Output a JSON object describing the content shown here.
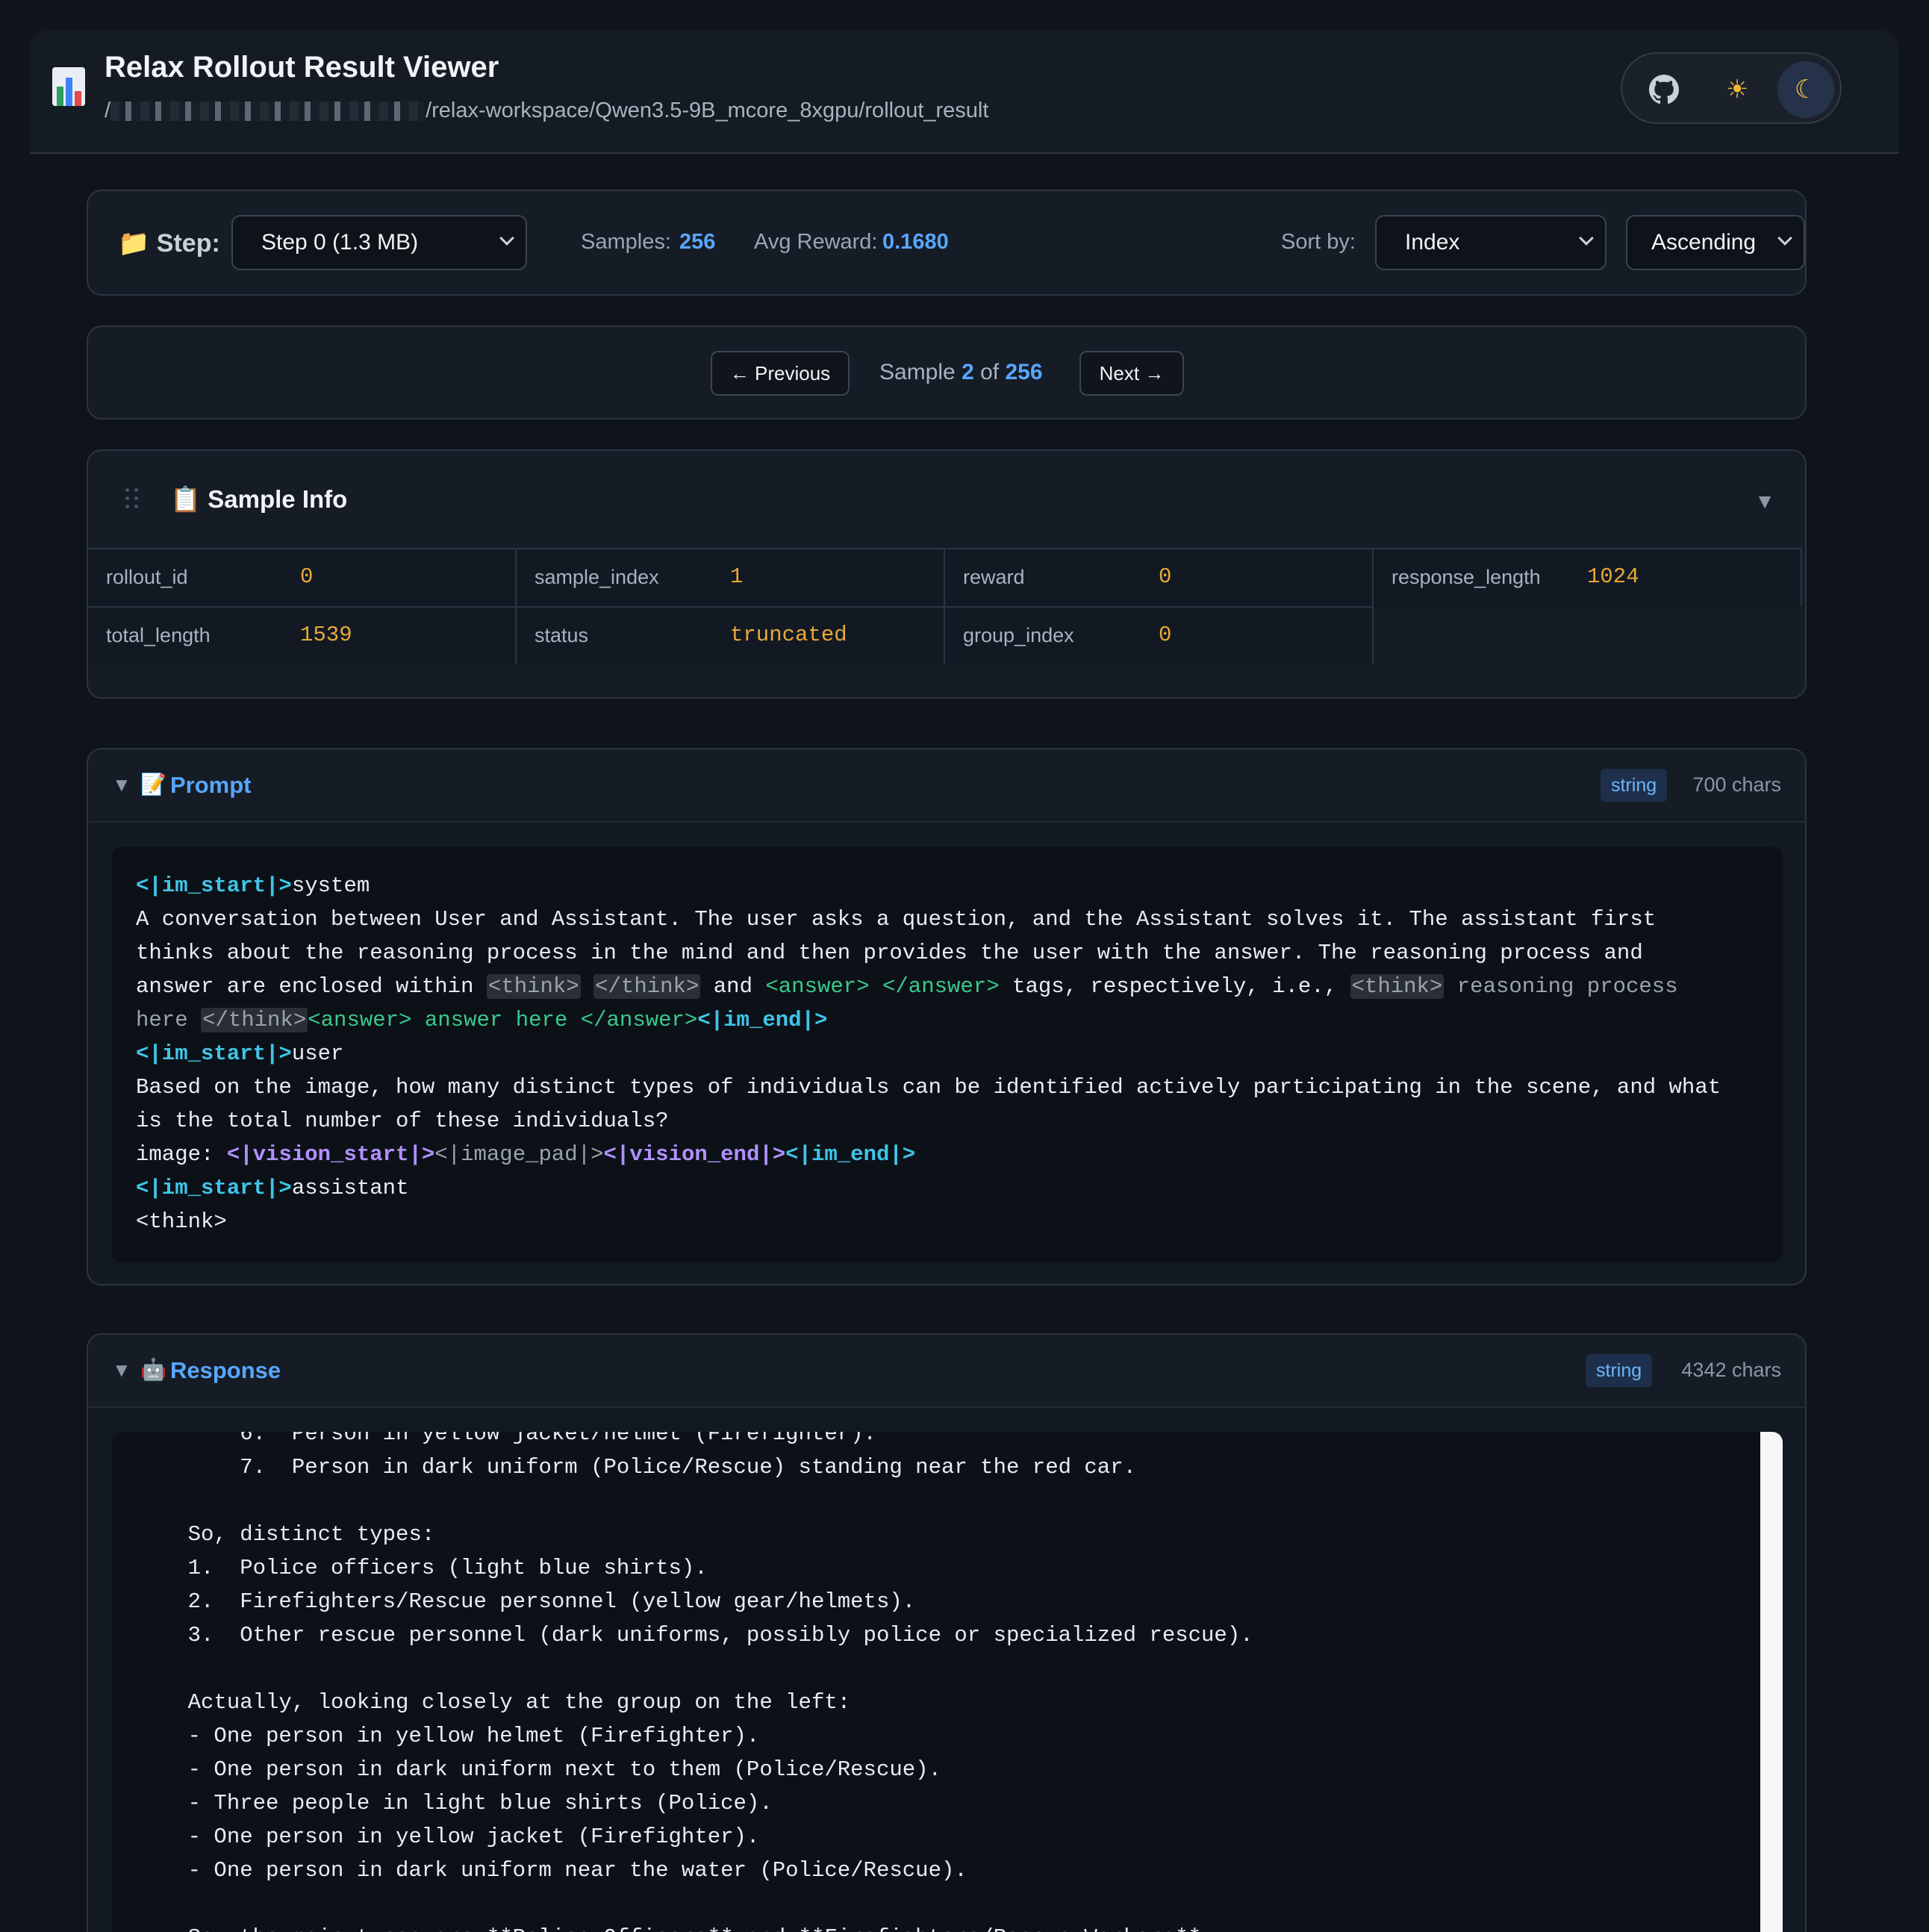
{
  "header": {
    "title": "Relax Rollout Result Viewer",
    "path_suffix": "/relax-workspace/Qwen3.5-9B_mcore_8xgpu/rollout_result",
    "path_prefix": "/"
  },
  "theme": {
    "github_icon": "github-icon",
    "light_icon": "☀",
    "dark_icon": "☾"
  },
  "controls": {
    "step_label": "Step:",
    "step_value": "Step 0 (1.3 MB)",
    "samples_label": "Samples:",
    "samples_value": "256",
    "avg_reward_label": "Avg Reward:",
    "avg_reward_value": "0.1680",
    "sort_label": "Sort by:",
    "sort_value": "Index",
    "order_value": "Ascending"
  },
  "nav": {
    "prev_label": "← Previous",
    "next_label": "Next →",
    "sample_word": "Sample",
    "current": "2",
    "of_word": "of",
    "total": "256"
  },
  "sample_info": {
    "title": "Sample Info",
    "fields": [
      {
        "key": "rollout_id",
        "value": "0"
      },
      {
        "key": "sample_index",
        "value": "1"
      },
      {
        "key": "reward",
        "value": "0"
      },
      {
        "key": "response_length",
        "value": "1024"
      },
      {
        "key": "total_length",
        "value": "1539"
      },
      {
        "key": "status",
        "value": "truncated"
      },
      {
        "key": "group_index",
        "value": "0"
      }
    ]
  },
  "prompt": {
    "title": "Prompt",
    "type_badge": "string",
    "chars": "700 chars"
  },
  "response": {
    "title": "Response",
    "type_badge": "string",
    "chars": "4342 chars"
  }
}
